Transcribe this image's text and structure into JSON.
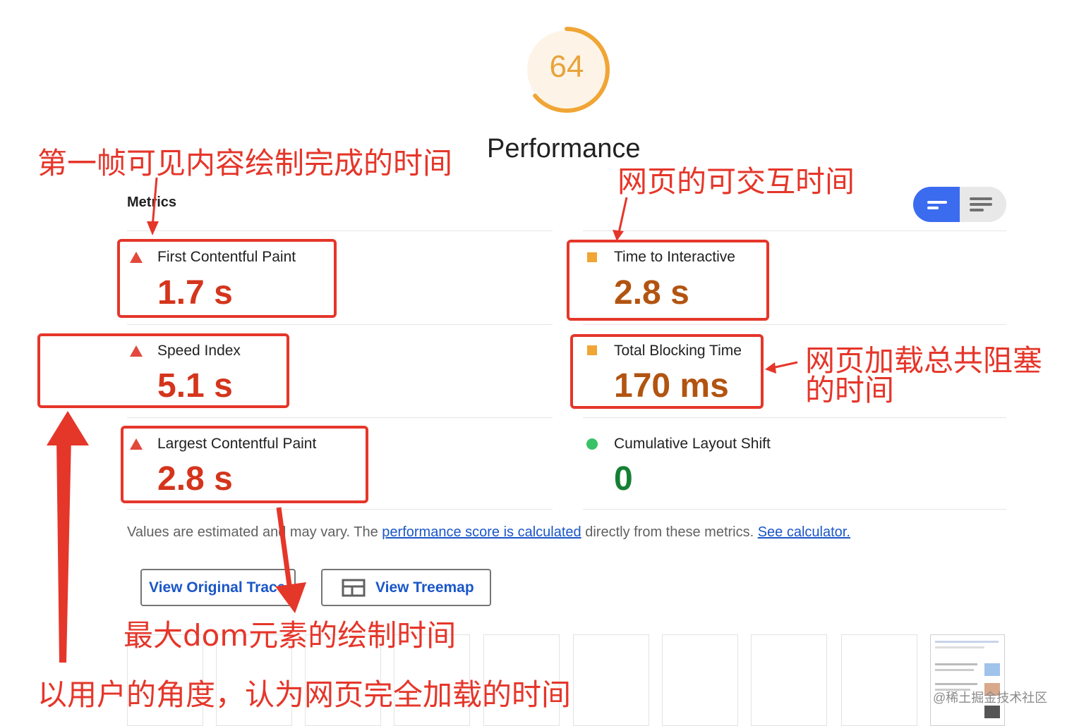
{
  "gauge": {
    "score": "64",
    "score_fraction": 0.64,
    "title": "Performance",
    "color": "#e8a33b"
  },
  "metrics": {
    "title": "Metrics",
    "items": [
      {
        "label": "First Contentful Paint",
        "value": "1.7 s",
        "status": "fail"
      },
      {
        "label": "Time to Interactive",
        "value": "2.8 s",
        "status": "average"
      },
      {
        "label": "Speed Index",
        "value": "5.1 s",
        "status": "fail"
      },
      {
        "label": "Total Blocking Time",
        "value": "170 ms",
        "status": "average"
      },
      {
        "label": "Largest Contentful Paint",
        "value": "2.8 s",
        "status": "fail"
      },
      {
        "label": "Cumulative Layout Shift",
        "value": "0",
        "status": "pass"
      }
    ]
  },
  "note": {
    "prefix": "Values are estimated and may vary. The ",
    "link1": "performance score is calculated",
    "middle": " directly from these metrics. ",
    "link2": "See calculator."
  },
  "buttons": {
    "trace": "View Original Trace",
    "treemap": "View Treemap"
  },
  "annotations": {
    "fcp": "第一帧可见内容绘制完成的时间",
    "tti": "网页的可交互时间",
    "tbt_line1": "网页加载总共阻塞",
    "tbt_line2": "的时间",
    "lcp": "最大dom元素的绘制时间",
    "si": "以用户的角度，认为网页完全加载的时间"
  },
  "watermark": "@稀土掘金技术社区",
  "colors": {
    "fail": "#d4351c",
    "average": "#b25411",
    "pass": "#158033",
    "annotation": "#e5362a",
    "toggle_active": "#3b6cf0"
  }
}
